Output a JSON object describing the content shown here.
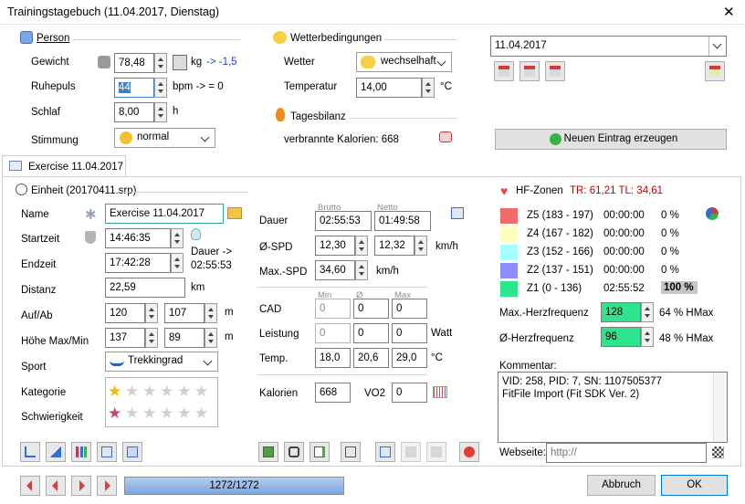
{
  "window": {
    "title": "Trainingstagebuch (11.04.2017, Dienstag)",
    "close": "✕"
  },
  "person": {
    "title": "Person",
    "weight_label": "Gewicht",
    "weight": "78,48",
    "weight_unit": "kg",
    "weight_delta": "-> -1,5",
    "rest_label": "Ruhepuls",
    "rest": "44",
    "rest_unit": "bpm  -> = 0",
    "sleep_label": "Schlaf",
    "sleep": "8,00",
    "sleep_unit": "h",
    "mood_label": "Stimmung",
    "mood": "normal"
  },
  "weather": {
    "title": "Wetterbedingungen",
    "label": "Wetter",
    "value": "wechselhaft",
    "temp_label": "Temperatur",
    "temp": "14,00",
    "temp_unit": "°C"
  },
  "balance": {
    "title": "Tagesbilanz",
    "calories": "verbrannte Kalorien: 668"
  },
  "date": {
    "value": "11.04.2017",
    "new_entry": "Neuen Eintrag erzeugen"
  },
  "tab": {
    "label": "Exercise 11.04.2017"
  },
  "unit": {
    "title": "Einheit (20170411.srp)"
  },
  "exercise": {
    "name_label": "Name",
    "name": "Exercise 11.04.2017",
    "start_label": "Startzeit",
    "start": "14:46:35",
    "end_label": "Endzeit",
    "end": "17:42:28",
    "duration_note_1": "Dauer ->",
    "duration_note_2": "02:55:53",
    "dist_label": "Distanz",
    "dist": "22,59",
    "dist_unit": "km",
    "updown_label": "Auf/Ab",
    "up": "120",
    "down": "107",
    "updown_unit": "m",
    "hmax_label": "Höhe Max/Min",
    "hmax": "137",
    "hmin": "89",
    "h_unit": "m",
    "sport_label": "Sport",
    "sport": "Trekkingrad",
    "cat_label": "Kategorie",
    "diff_label": "Schwierigkeit",
    "category_rating": 1,
    "difficulty_rating": 1
  },
  "stats": {
    "brutto": "Brutto",
    "netto": "Netto",
    "dur_label": "Dauer",
    "dur_b": "02:55:53",
    "dur_n": "01:49:58",
    "spd_label": "Ø-SPD",
    "spd_b": "12,30",
    "spd_n": "12,32",
    "spd_unit": "km/h",
    "max_label": "Max.-SPD",
    "max": "34,60",
    "max_unit": "km/h",
    "min_h": "Min",
    "avg_h": "Ø",
    "max_h": "Max",
    "cad_label": "CAD",
    "cad_min": "0",
    "cad_avg": "0",
    "cad_max": "0",
    "pow_label": "Leistung",
    "pow_min": "0",
    "pow_avg": "0",
    "pow_max": "0",
    "pow_unit": "Watt",
    "temp_label": "Temp.",
    "temp_min": "18,0",
    "temp_avg": "20,6",
    "temp_max": "29,0",
    "temp_unit": "°C",
    "kcal_label": "Kalorien",
    "kcal": "668",
    "vo2_label": "VO2",
    "vo2": "0"
  },
  "hr": {
    "title": "HF-Zonen",
    "tr": "TR: 61,21  TL: 34,61",
    "zones": [
      {
        "name": "Z5 (183 - 197)",
        "time": "00:00:00",
        "pct": "0 %",
        "color": "#f26b6b"
      },
      {
        "name": "Z4 (167 - 182)",
        "time": "00:00:00",
        "pct": "0 %",
        "color": "#ffffbf"
      },
      {
        "name": "Z3 (152 - 166)",
        "time": "00:00:00",
        "pct": "0 %",
        "color": "#a6ffff"
      },
      {
        "name": "Z2 (137 - 151)",
        "time": "00:00:00",
        "pct": "0 %",
        "color": "#8c8cff"
      },
      {
        "name": "Z1 (0 - 136)",
        "time": "02:55:52",
        "pct": "100 %",
        "color": "#2de58c"
      }
    ],
    "max_label": "Max.-Herzfrequenz",
    "max": "128",
    "max_pct": "64 % HMax",
    "avg_label": "Ø-Herzfrequenz",
    "avg": "96",
    "avg_pct": "48 % HMax"
  },
  "comment": {
    "label": "Kommentar:",
    "text_1": "VID: 258, PID: 7, SN: 1107505377",
    "text_2": "FitFile Import (Fit SDK Ver. 2)",
    "web_label": "Webseite:",
    "web_placeholder": "http://"
  },
  "footer": {
    "progress_text": "1272/1272",
    "progress": 1.0,
    "cancel": "Abbruch",
    "ok": "OK"
  },
  "colors": {
    "accent": "#3c7fd1",
    "tr_red": "#c00000",
    "progress_fill": "#8fb4e6"
  }
}
